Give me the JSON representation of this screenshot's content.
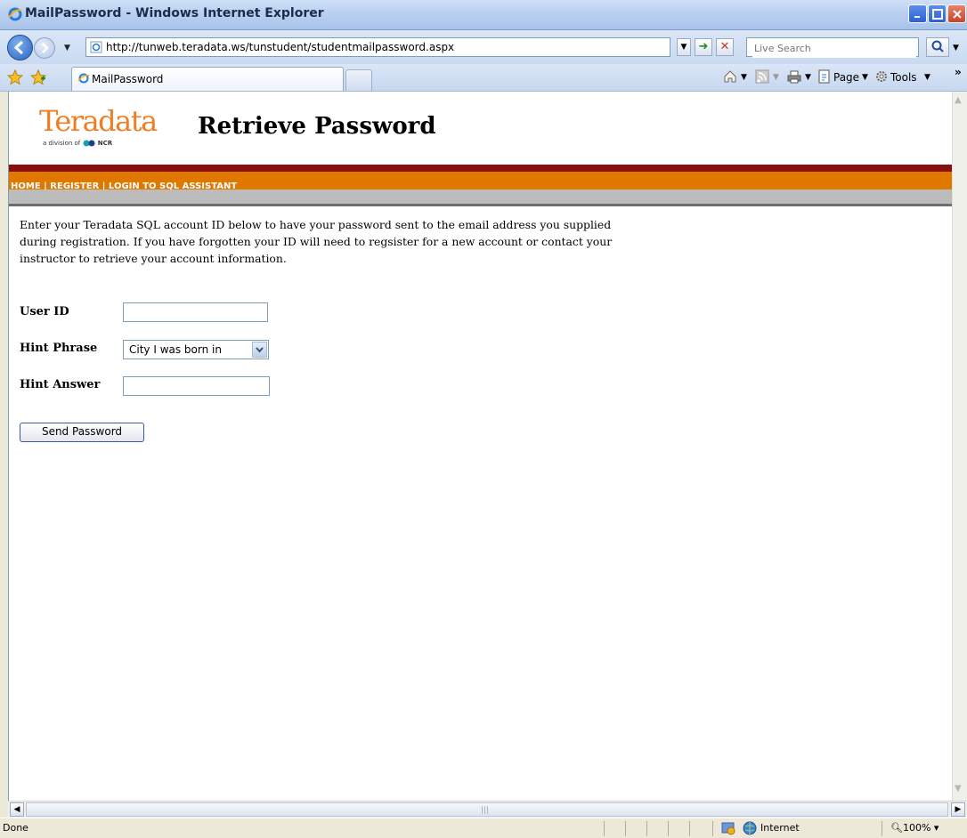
{
  "window": {
    "title": "MailPassword - Windows Internet Explorer"
  },
  "address_bar": {
    "url": "http://tunweb.teradata.ws/tunstudent/studentmailpassword.aspx"
  },
  "search": {
    "placeholder": "Live Search"
  },
  "tabs": [
    {
      "label": "MailPassword"
    }
  ],
  "commands": {
    "page": "Page",
    "tools": "Tools"
  },
  "page": {
    "logo": "Teradata",
    "logo_sub": "a division of",
    "logo_ncr": "NCR",
    "title": "Retrieve Password",
    "nav": [
      "HOME",
      "REGISTER",
      "LOGIN TO SQL ASSISTANT"
    ],
    "nav_sep": " | ",
    "intro": "Enter your Teradata SQL account ID below to have your password sent to the email address you supplied during registration. If you have forgotten your ID will need to regsister for a new account or contact your instructor to retrieve your account information.",
    "form": {
      "user_id_label": "User ID",
      "user_id_value": "",
      "hint_phrase_label": "Hint Phrase",
      "hint_phrase_value": "City I was born in",
      "hint_answer_label": "Hint Answer",
      "hint_answer_value": "",
      "submit_label": "Send Password"
    }
  },
  "status": {
    "text": "Done",
    "zone": "Internet",
    "zoom": "100%"
  },
  "colors": {
    "brand_orange": "#e07800",
    "maroon": "#8a0f10",
    "logo": "#ef7d23"
  }
}
